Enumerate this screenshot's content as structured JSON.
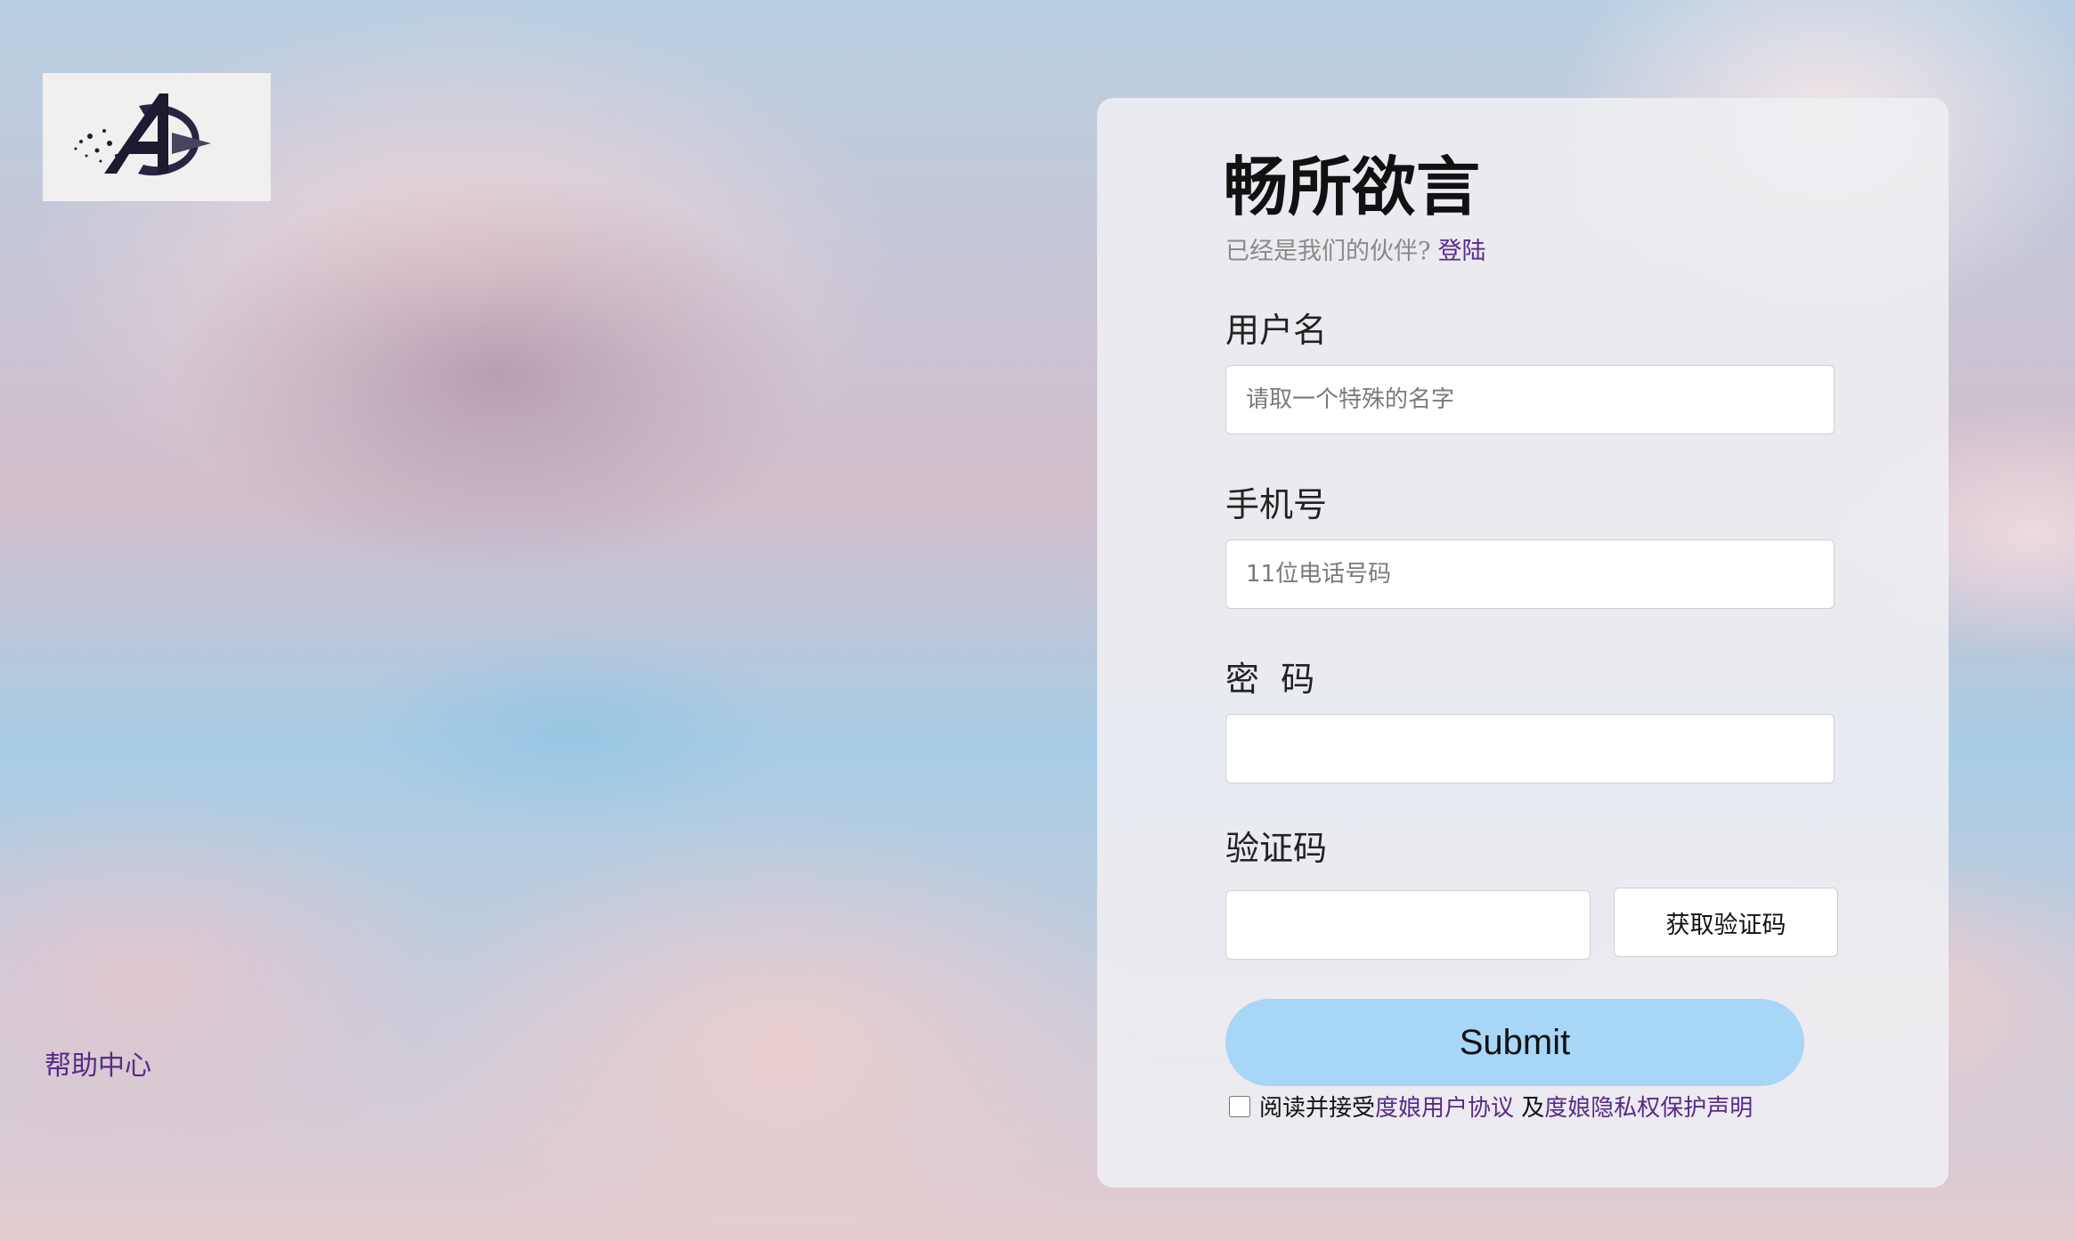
{
  "logo": {
    "icon": "avengers-a-logo-icon"
  },
  "help_link": "帮助中心",
  "form": {
    "title": "畅所欲言",
    "subtitle": "已经是我们的伙伴?",
    "login_link": "登陆",
    "username": {
      "label": "用户名",
      "placeholder": "请取一个特殊的名字",
      "value": ""
    },
    "phone": {
      "label": "手机号",
      "placeholder": "11位电话号码",
      "value": ""
    },
    "password": {
      "label": "密  码",
      "placeholder": "",
      "value": ""
    },
    "code": {
      "label": "验证码",
      "placeholder": "",
      "value": "",
      "button_label": "获取验证码"
    },
    "submit_label": "Submit",
    "agreement": {
      "prefix": "阅读并接受",
      "user_agreement": "度娘用户协议",
      "middle": " 及",
      "privacy": "度娘隐私权保护声明",
      "checked": false
    }
  },
  "colors": {
    "link": "#5a2a8a",
    "submit_bg": "#a8d6f6",
    "card_bg": "#eeeef2"
  }
}
